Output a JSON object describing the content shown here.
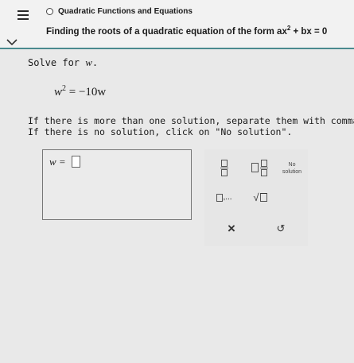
{
  "header": {
    "topic": "Quadratic Functions and Equations",
    "title_prefix": "Finding the roots of a quadratic equation of the form ax",
    "title_exponent": "2",
    "title_suffix": " + bx = 0"
  },
  "question": {
    "instruction_prefix": "Solve for ",
    "variable": "w",
    "instruction_suffix": ".",
    "equation_base": "w",
    "equation_exponent": "2",
    "equation_rest": "= −10w",
    "note_line1": "If there is more than one solution, separate them with commas.",
    "note_line2": "If there is no solution, click on \"No solution\"."
  },
  "answer": {
    "label": "w =",
    "value": ""
  },
  "keypad": {
    "no_solution_line1": "No",
    "no_solution_line2": "solution",
    "list_separator": ",...",
    "sqrt_symbol": "√",
    "clear_symbol": "×",
    "undo_symbol": "↺"
  }
}
